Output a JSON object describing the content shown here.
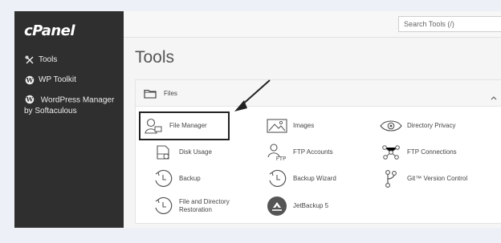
{
  "app": {
    "logo": "cPanel"
  },
  "sidebar": {
    "items": [
      {
        "label": "Tools",
        "icon": "tools-icon"
      },
      {
        "label": "WP Toolkit",
        "icon": "wordpress-icon"
      },
      {
        "label": "WordPress Manager by Softaculous",
        "icon": "wordpress-icon"
      }
    ]
  },
  "search": {
    "placeholder": "Search Tools (/)"
  },
  "page": {
    "title": "Tools"
  },
  "panel": {
    "title": "Files",
    "tools": [
      {
        "label": "File Manager",
        "icon": "file-manager-icon"
      },
      {
        "label": "Images",
        "icon": "images-icon"
      },
      {
        "label": "Directory Privacy",
        "icon": "eye-icon"
      },
      {
        "label": "Disk Usage",
        "icon": "disk-icon"
      },
      {
        "label": "FTP Accounts",
        "icon": "ftp-user-icon"
      },
      {
        "label": "FTP Connections",
        "icon": "connections-icon"
      },
      {
        "label": "Backup",
        "icon": "backup-icon"
      },
      {
        "label": "Backup Wizard",
        "icon": "backup-wizard-icon"
      },
      {
        "label": "Git™ Version Control",
        "icon": "git-icon"
      },
      {
        "label": "File and Directory Restoration",
        "icon": "restore-icon"
      },
      {
        "label": "JetBackup 5",
        "icon": "jetbackup-icon"
      }
    ]
  }
}
